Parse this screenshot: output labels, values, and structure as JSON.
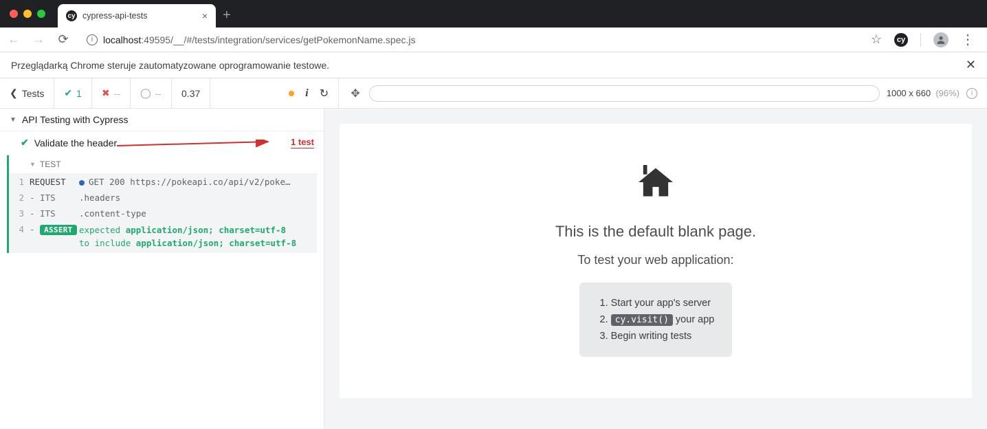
{
  "browser": {
    "tab_title": "cypress-api-tests",
    "favicon_label": "cy",
    "url_host": "localhost",
    "url_port_path": ":49595/__/#/tests/integration/services/getPokemonName.spec.js",
    "automation_banner": "Przeglądarką Chrome steruje zautomatyzowane oprogramowanie testowe.",
    "cy_badge": "cy"
  },
  "header": {
    "tests_link": "Tests",
    "passed": "1",
    "failed": "--",
    "pending": "--",
    "duration": "0.37",
    "viewport": "1000 x 660",
    "viewport_pct": "(96%)"
  },
  "suite": {
    "title": "API Testing with Cypress",
    "test_title": "Validate the header",
    "test_count_label": "1 test",
    "body_label": "TEST",
    "commands": [
      {
        "n": "1",
        "name": "REQUEST",
        "msg_prefix": "GET 200 ",
        "msg": "https://pokeapi.co/api/v2/poke…"
      },
      {
        "n": "2",
        "name": "- ITS",
        "msg": ".headers"
      },
      {
        "n": "3",
        "name": "- ITS",
        "msg": ".content-type"
      },
      {
        "n": "4",
        "name": "-",
        "pill": "ASSERT",
        "assert_parts": {
          "e": "expected ",
          "v1": "application/json; charset=utf-8",
          "mid": "to include ",
          "v2": "application/json; charset=utf-8"
        }
      }
    ]
  },
  "aut": {
    "h1": "This is the default blank page.",
    "h2": "To test your web application:",
    "steps": {
      "s1": "Start your app's server",
      "s2_code": "cy.visit()",
      "s2_rest": " your app",
      "s3": "Begin writing tests"
    }
  }
}
